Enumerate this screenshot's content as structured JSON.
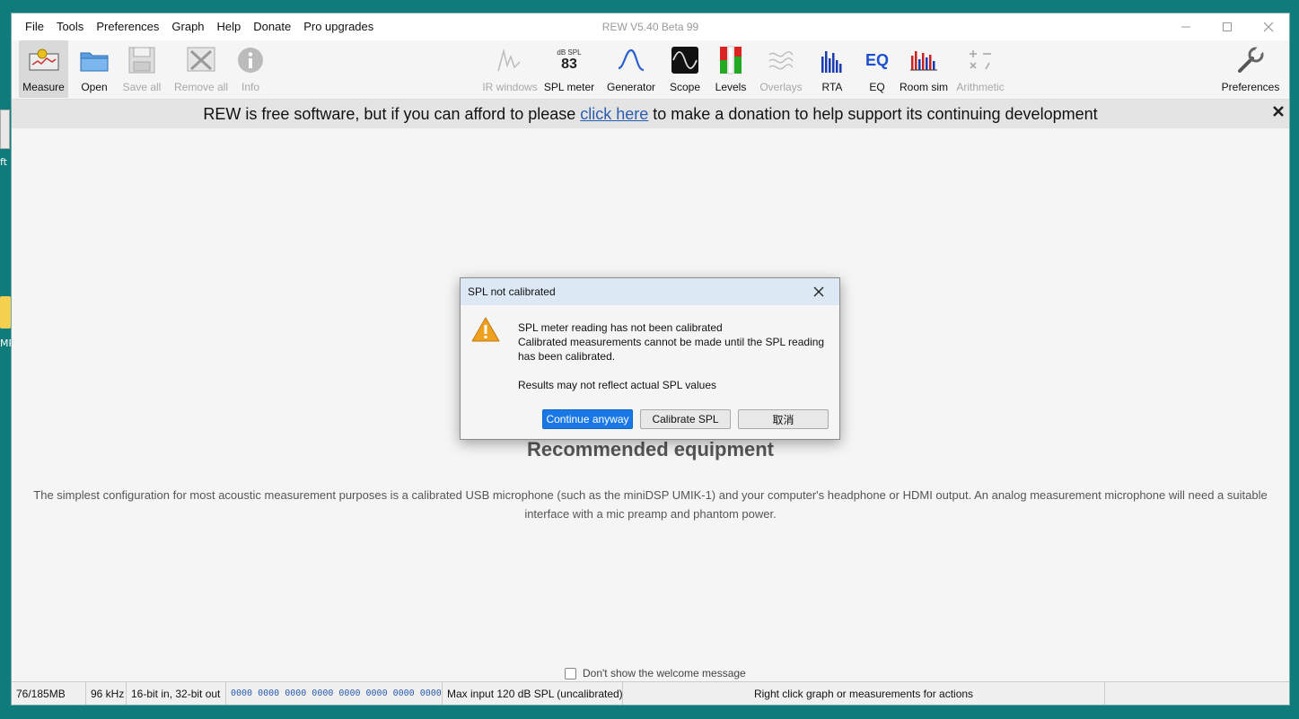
{
  "desktop": {
    "frag1": "ft",
    "frag2": "MP"
  },
  "window": {
    "title": "REW V5.40 Beta 99",
    "menu": [
      "File",
      "Tools",
      "Preferences",
      "Graph",
      "Help",
      "Donate",
      "Pro upgrades"
    ]
  },
  "toolbar": {
    "measure": "Measure",
    "open": "Open",
    "save_all": "Save all",
    "remove_all": "Remove all",
    "info": "Info",
    "ir_windows": "IR windows",
    "spl_meter": "SPL meter",
    "spl_unit": "dB SPL",
    "spl_value": "83",
    "generator": "Generator",
    "scope": "Scope",
    "levels": "Levels",
    "overlays": "Overlays",
    "rta": "RTA",
    "eq": "EQ",
    "eq_icon_text": "EQ",
    "room_sim": "Room sim",
    "arithmetic": "Arithmetic",
    "preferences": "Preferences"
  },
  "banner": {
    "before": "REW is free software, but if you can afford to please",
    "link": "click here",
    "after": "to make a donation to help support its continuing development"
  },
  "content": {
    "title": "Recommended equipment",
    "text": "The simplest configuration for most acoustic measurement purposes is a calibrated USB microphone (such as the miniDSP UMIK-1) and your computer's headphone or HDMI output. An analog measurement microphone will need a suitable interface with a mic preamp and phantom power.",
    "welcome_check": "Don't show the welcome message"
  },
  "statusbar": {
    "memory": "76/185MB",
    "rate": "96 kHz",
    "bits": "16-bit in, 32-bit out",
    "hex": "0000 0000  0000 0000  0000 0000  0000 0000",
    "max_input": "Max input 120 dB SPL (uncalibrated)",
    "hint": "Right click graph or measurements for actions"
  },
  "dialog": {
    "title": "SPL not calibrated",
    "line1": "SPL meter reading has not been calibrated",
    "line2": "Calibrated measurements cannot be made until the SPL reading",
    "line3": "has been calibrated.",
    "line4": "Results may not reflect actual SPL values",
    "btn_continue": "Continue anyway",
    "btn_calibrate": "Calibrate SPL",
    "btn_cancel": "取消"
  }
}
